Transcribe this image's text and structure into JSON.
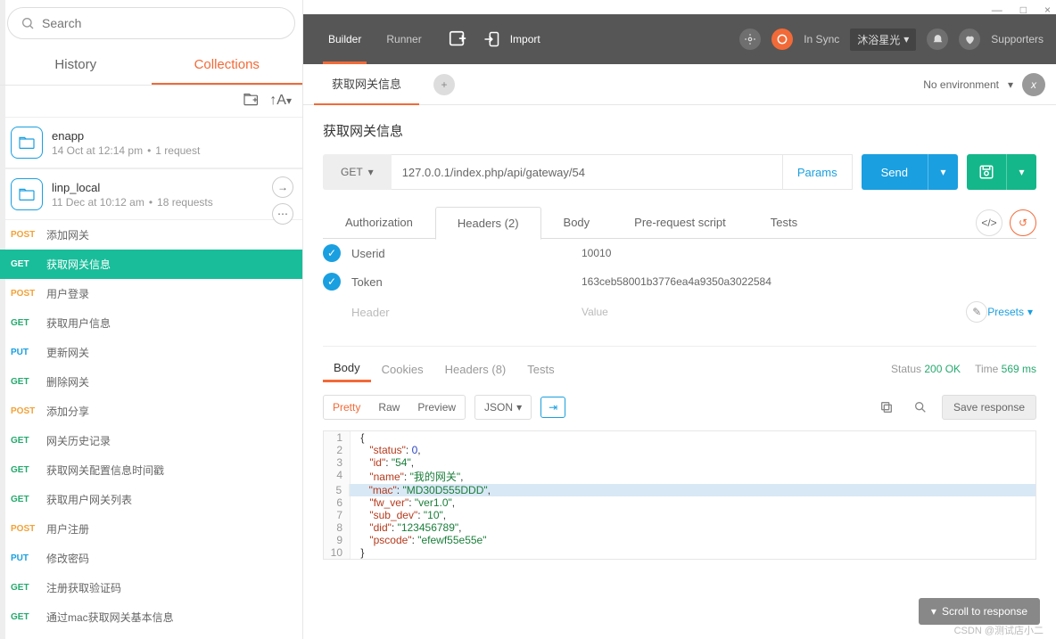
{
  "window": {
    "min": "—",
    "max": "□",
    "close": "×"
  },
  "search": {
    "placeholder": "Search"
  },
  "sidebar_tabs": {
    "history": "History",
    "collections": "Collections"
  },
  "toolbar_sort": {
    "addfolder": "⊞",
    "sort": "↑A▾"
  },
  "collections": [
    {
      "name": "enapp",
      "meta_date": "14 Oct at 12:14 pm",
      "meta_count": "1 request"
    },
    {
      "name": "linp_local",
      "meta_date": "11 Dec at 10:12 am",
      "meta_count": "18 requests"
    }
  ],
  "requests": [
    {
      "method": "POST",
      "mclass": "m-post",
      "name": "添加网关"
    },
    {
      "method": "GET",
      "mclass": "m-get",
      "name": "获取网关信息",
      "active": true
    },
    {
      "method": "POST",
      "mclass": "m-post",
      "name": "用户登录"
    },
    {
      "method": "GET",
      "mclass": "m-get",
      "name": "获取用户信息"
    },
    {
      "method": "PUT",
      "mclass": "m-put",
      "name": "更新网关"
    },
    {
      "method": "GET",
      "mclass": "m-get",
      "name": "删除网关"
    },
    {
      "method": "POST",
      "mclass": "m-post",
      "name": "添加分享"
    },
    {
      "method": "GET",
      "mclass": "m-get",
      "name": "网关历史记录"
    },
    {
      "method": "GET",
      "mclass": "m-get",
      "name": "获取网关配置信息时间戳"
    },
    {
      "method": "GET",
      "mclass": "m-get",
      "name": "获取用户网关列表"
    },
    {
      "method": "POST",
      "mclass": "m-post",
      "name": "用户注册"
    },
    {
      "method": "PUT",
      "mclass": "m-put",
      "name": "修改密码"
    },
    {
      "method": "GET",
      "mclass": "m-get",
      "name": "注册获取验证码"
    },
    {
      "method": "GET",
      "mclass": "m-get",
      "name": "通过mac获取网关基本信息"
    }
  ],
  "top_toolbar": {
    "builder": "Builder",
    "runner": "Runner",
    "import": "Import",
    "sync": "In Sync",
    "user": "沐浴星光",
    "supporters": "Supporters"
  },
  "tabs": {
    "title": "获取网关信息",
    "env": "No environment",
    "env_x": "x"
  },
  "builder": {
    "title": "获取网关信息",
    "method": "GET",
    "url": "127.0.0.1/index.php/api/gateway/54",
    "params": "Params",
    "send": "Send"
  },
  "req_subtabs": {
    "auth": "Authorization",
    "headers": "Headers (2)",
    "body": "Body",
    "prs": "Pre-request script",
    "tests": "Tests"
  },
  "headers": [
    {
      "key": "Userid",
      "value": "10010"
    },
    {
      "key": "Token",
      "value": "163ceb58001b3776ea4a9350a3022584"
    }
  ],
  "headers_placeholder": {
    "key": "Header",
    "value": "Value"
  },
  "presets_label": "Presets",
  "resp_tabs": {
    "body": "Body",
    "cookies": "Cookies",
    "headers": "Headers (8)",
    "tests": "Tests"
  },
  "resp_status": {
    "status_lbl": "Status",
    "status_val": "200 OK",
    "time_lbl": "Time",
    "time_val": "569 ms"
  },
  "pretty_tabs": {
    "pretty": "Pretty",
    "raw": "Raw",
    "preview": "Preview",
    "json": "JSON"
  },
  "save_response": "Save response",
  "json_body": {
    "status": 0,
    "id": "54",
    "name": "我的网关",
    "mac": "MD30D555DDD",
    "fw_ver": "ver1.0",
    "sub_dev": "10",
    "did": "123456789",
    "pscode": "efewf55e55e"
  },
  "scroll_btn": "Scroll to response",
  "watermark": "CSDN @测试店小二"
}
